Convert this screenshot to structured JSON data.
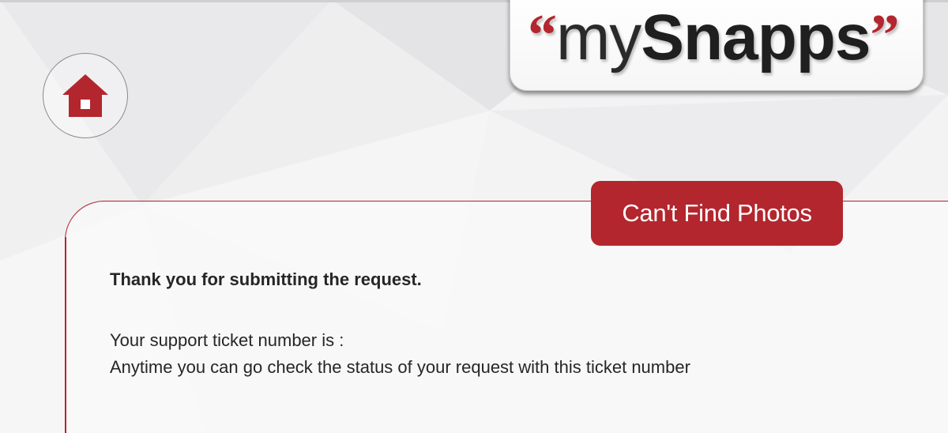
{
  "logo": {
    "open_quote": "“",
    "my": "my",
    "snapps": "Snapps",
    "close_quote": "”"
  },
  "home": {
    "icon": "home-icon"
  },
  "panel": {
    "title": "Can't Find Photos",
    "thanks": "Thank you for submitting the request.",
    "ticket_label": "Your support ticket number is :",
    "ticket_number": "",
    "anytime": "Anytime you can go check the status of your request with this ticket number"
  },
  "colors": {
    "accent": "#b3262e",
    "text": "#262626",
    "background": "#f3f3f4"
  }
}
